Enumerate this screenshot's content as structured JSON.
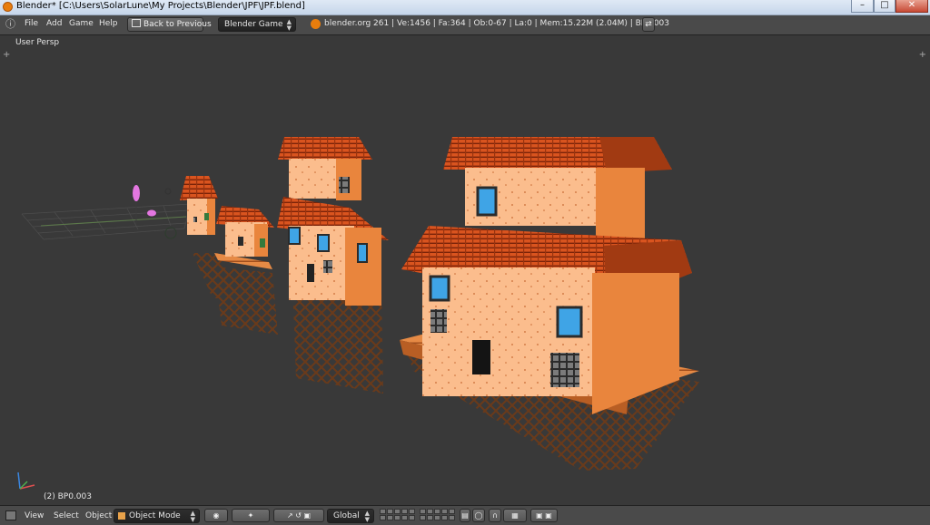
{
  "window": {
    "title": "Blender* [C:\\Users\\SolarLune\\My Projects\\Blender\\JPF\\JPF.blend]",
    "minimize_glyph": "–",
    "maximize_glyph": "□",
    "close_glyph": "✕"
  },
  "header": {
    "menus": [
      "File",
      "Add",
      "Game",
      "Help"
    ],
    "back_button": "Back to Previous",
    "engine": "Blender Game",
    "stats": "blender.org 261 | Ve:1456 | Fa:364 | Ob:0-67 | La:0 | Mem:15.22M (2.04M) | BP0.003"
  },
  "viewport": {
    "view_label": "User Persp",
    "active_object_label": "(2) BP0.003"
  },
  "footer": {
    "menus": [
      "View",
      "Select",
      "Object"
    ],
    "mode": "Object Mode",
    "orientation": "Global"
  },
  "icons": {
    "app": "blender-logo-icon",
    "editor": "editor-type-icon",
    "axes": "axis-gizmo-icon"
  },
  "colors": {
    "roof": "#c8451a",
    "wall": "#f7b07a",
    "wall_shadow": "#e9853d",
    "deck": "#e28a43",
    "stilts": "#6a3a1a",
    "window_glass": "#3fa4e6"
  }
}
